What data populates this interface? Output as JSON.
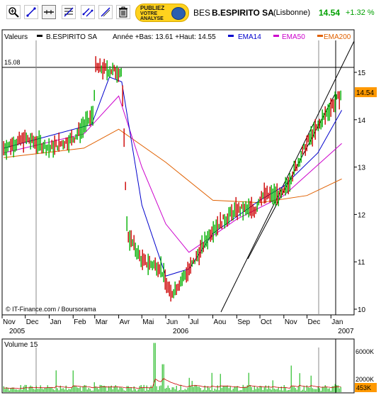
{
  "toolbar": {
    "tools": [
      {
        "name": "zoom-tool",
        "icon": "magnifier-plus-icon"
      },
      {
        "name": "line-tool",
        "icon": "line-icon"
      },
      {
        "name": "horizontal-line-tool",
        "icon": "horizontal-line-icon"
      },
      {
        "name": "fibonacci-tool",
        "icon": "fibonacci-icon"
      },
      {
        "name": "channel-tool",
        "icon": "channel-icon"
      },
      {
        "name": "parallel-line-tool",
        "icon": "parallel-line-icon"
      },
      {
        "name": "delete-tool",
        "icon": "trash-icon"
      }
    ],
    "ad": {
      "line1": "PUBLIEZ",
      "line2": "VOTRE",
      "line3": "ANALYSE"
    }
  },
  "header": {
    "code": "BES",
    "name": "B.ESPIRITO SA",
    "market": "(Lisbonne)",
    "price": "14.54",
    "change": "+1.32 %",
    "change_color": "#00a000",
    "price_color": "#00a000"
  },
  "legend": {
    "label": "Valeurs",
    "stock": "B.ESPIRITO SA",
    "info": "Année +Bas: 13.61 +Haut: 14.55",
    "ema14": "EMA14",
    "ema50": "EMA50",
    "ema200": "EMA200",
    "colors": {
      "stock": "#000000",
      "ema14": "#0000cc",
      "ema50": "#cc00cc",
      "ema200": "#e06000"
    }
  },
  "price_chart": {
    "y_ticks": [
      "15",
      "14",
      "13",
      "12",
      "11",
      "10"
    ],
    "hline_label": "15.08",
    "last_price_label": "14.54",
    "copyright": "© IT-Finance.com / Boursorama",
    "x_ticks": [
      "Nov",
      "Dec",
      "Jan",
      "Feb",
      "Mar",
      "Avr",
      "Mai",
      "Jun",
      "Jul",
      "Aou",
      "Sep",
      "Oct",
      "Nov",
      "Dec",
      "Jan"
    ],
    "years": [
      "2005",
      "2006",
      "2007"
    ]
  },
  "volume_chart": {
    "label": "Volume 15",
    "y_ticks": [
      "6000K",
      "2000K"
    ],
    "last_volume_label": "453K"
  },
  "chart_data": {
    "type": "line",
    "x_range": [
      "2005-11-01",
      "2007-01-31"
    ],
    "ylim": [
      10,
      15.6
    ],
    "grid": false,
    "legend_position": "top",
    "series": [
      {
        "name": "B.ESPIRITO SA",
        "points": [
          [
            "2005-11-03",
            13.4
          ],
          [
            "2005-12-01",
            13.6
          ],
          [
            "2006-01-02",
            13.4
          ],
          [
            "2006-02-01",
            13.6
          ],
          [
            "2006-02-27",
            14.1
          ],
          [
            "2006-03-02",
            15.1
          ],
          [
            "2006-04-05",
            15.0
          ],
          [
            "2006-04-12",
            11.6
          ],
          [
            "2006-05-02",
            11.0
          ],
          [
            "2006-05-25",
            10.9
          ],
          [
            "2006-06-07",
            10.3
          ],
          [
            "2006-07-04",
            10.9
          ],
          [
            "2006-08-01",
            11.7
          ],
          [
            "2006-09-01",
            12.1
          ],
          [
            "2006-09-25",
            12.1
          ],
          [
            "2006-10-02",
            12.4
          ],
          [
            "2006-10-30",
            12.4
          ],
          [
            "2006-12-01",
            13.5
          ],
          [
            "2007-01-02",
            14.3
          ],
          [
            "2007-01-15",
            14.54
          ]
        ]
      },
      {
        "name": "EMA14",
        "points": [
          [
            "2005-11-03",
            13.4
          ],
          [
            "2006-02-25",
            13.9
          ],
          [
            "2006-03-20",
            14.9
          ],
          [
            "2006-04-05",
            14.8
          ],
          [
            "2006-05-01",
            12.2
          ],
          [
            "2006-06-01",
            10.7
          ],
          [
            "2006-07-01",
            10.85
          ],
          [
            "2006-08-01",
            11.6
          ],
          [
            "2006-10-01",
            12.3
          ],
          [
            "2006-11-01",
            12.6
          ],
          [
            "2006-12-15",
            13.3
          ],
          [
            "2007-01-15",
            14.2
          ]
        ]
      },
      {
        "name": "EMA50",
        "points": [
          [
            "2005-11-03",
            13.3
          ],
          [
            "2006-02-15",
            13.7
          ],
          [
            "2006-04-01",
            14.5
          ],
          [
            "2006-05-01",
            13.0
          ],
          [
            "2006-06-01",
            11.8
          ],
          [
            "2006-07-01",
            11.2
          ],
          [
            "2006-09-01",
            11.9
          ],
          [
            "2006-11-01",
            12.4
          ],
          [
            "2007-01-15",
            13.5
          ]
        ]
      },
      {
        "name": "EMA200",
        "points": [
          [
            "2005-11-03",
            13.2
          ],
          [
            "2006-02-15",
            13.4
          ],
          [
            "2006-04-01",
            13.8
          ],
          [
            "2006-06-01",
            13.1
          ],
          [
            "2006-08-01",
            12.3
          ],
          [
            "2006-10-01",
            12.25
          ],
          [
            "2006-12-01",
            12.4
          ],
          [
            "2007-01-15",
            12.75
          ]
        ]
      }
    ],
    "volume_ylim": [
      0,
      8000
    ]
  }
}
